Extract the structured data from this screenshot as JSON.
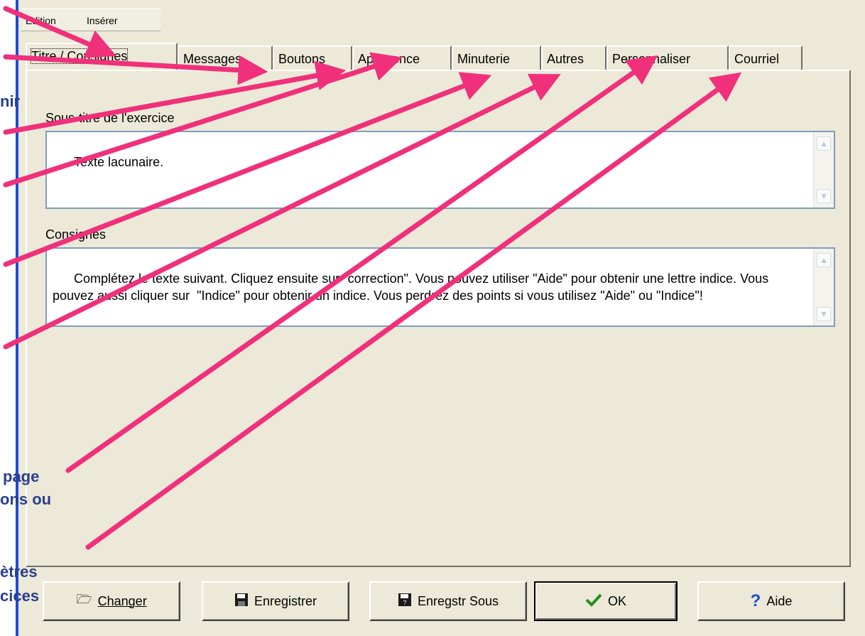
{
  "menu": {
    "edition": "Edition",
    "inserer": "Insérer"
  },
  "tabs": [
    {
      "label": "Titre / Consignes",
      "active": true
    },
    {
      "label": "Messages"
    },
    {
      "label": "Boutons"
    },
    {
      "label": "Apparence"
    },
    {
      "label": "Minuterie"
    },
    {
      "label": "Autres"
    },
    {
      "label": "Personnaliser"
    },
    {
      "label": "Courriel"
    }
  ],
  "subtitle": {
    "label": "Sous-titre de l'exercice",
    "value": "Texte lacunaire."
  },
  "instructions": {
    "label": "Consignes",
    "value": "Complétez le texte suivant. Cliquez ensuite sur \"correction\". Vous pouvez utiliser \"Aide\" pour obtenir une lettre indice. Vous pouvez aussi cliquer sur  \"Indice\" pour obtenir un indice. Vous perdrez des points si vous utilisez \"Aide\" ou \"Indice\"!"
  },
  "buttons": {
    "changer": "Changer",
    "enregistrer": "Enregistrer",
    "enregistrer_sous": "Enregstr Sous",
    "ok": "OK",
    "aide": "Aide"
  },
  "annotations": {
    "a1": "nir",
    "a2": "page",
    "a3": "ons ou",
    "a4": "ètres",
    "a5": "cices"
  },
  "colors": {
    "accent": "#f0307a",
    "annotation": "#2a3f8f",
    "window_border": "#1e4bd8"
  }
}
